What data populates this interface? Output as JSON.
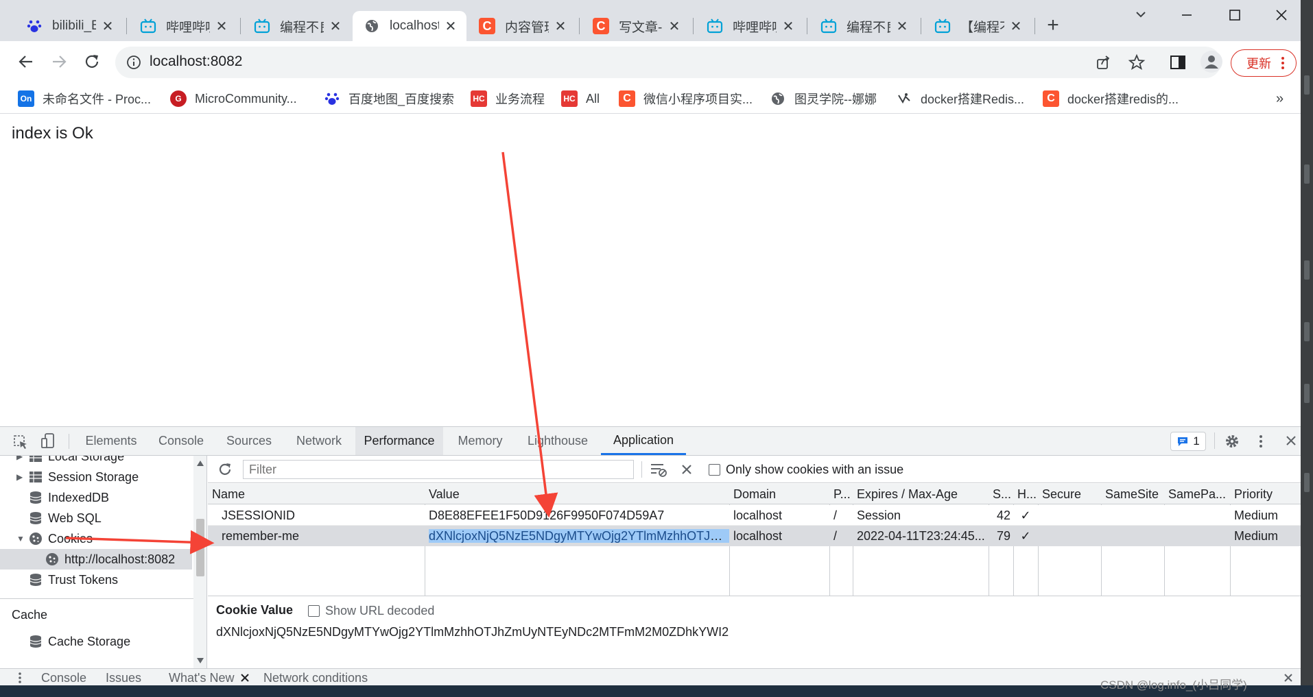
{
  "browser": {
    "tabs": [
      {
        "title": "bilibili_B",
        "icon": "baidu-paw-icon"
      },
      {
        "title": "哔哩哔哩",
        "icon": "bilibili-tv-icon"
      },
      {
        "title": "编程不良",
        "icon": "bilibili-tv-icon"
      },
      {
        "title": "localhost",
        "icon": "globe-icon",
        "active": true
      },
      {
        "title": "内容管理",
        "icon": "csdn-c-icon"
      },
      {
        "title": "写文章-C",
        "icon": "csdn-c-icon"
      },
      {
        "title": "哔哩哔哩",
        "icon": "bilibili-tv-icon"
      },
      {
        "title": "编程不良",
        "icon": "bilibili-tv-icon"
      },
      {
        "title": "【编程不",
        "icon": "bilibili-tv-icon"
      }
    ],
    "new_tab": "+",
    "address": "localhost:8082",
    "update_label": "更新",
    "bookmarks": [
      {
        "label": "未命名文件 - Proc...",
        "icon": "on-icon"
      },
      {
        "label": "MicroCommunity...",
        "icon": "gitee-icon"
      },
      {
        "label": "百度地图_百度搜索",
        "icon": "baidu-paw-icon"
      },
      {
        "label": "业务流程",
        "icon": "hc-icon"
      },
      {
        "label": "All",
        "icon": "hc-icon"
      },
      {
        "label": "微信小程序项目实...",
        "icon": "csdn-c-icon"
      },
      {
        "label": "图灵学院--娜娜",
        "icon": "globe-icon"
      },
      {
        "label": "docker搭建Redis...",
        "icon": "bird-icon"
      },
      {
        "label": "docker搭建redis的...",
        "icon": "csdn-c-icon"
      }
    ],
    "bookmarks_more": "»",
    "colors": {
      "tabstrip": "#dee1e6",
      "accent": "#1a73e8",
      "csdn": "#fc5531",
      "bilibili": "#00a1d6",
      "hc": "#e53935"
    }
  },
  "page": {
    "text": "index is Ok"
  },
  "devtools": {
    "tabs": [
      "Elements",
      "Console",
      "Sources",
      "Network",
      "Performance",
      "Memory",
      "Lighthouse",
      "Application"
    ],
    "active_tab": "Application",
    "issues_count": "1",
    "sidebar": {
      "items": [
        {
          "label": "Local Storage",
          "icon": "grid-icon"
        },
        {
          "label": "Session Storage",
          "icon": "grid-icon"
        },
        {
          "label": "IndexedDB",
          "icon": "database-icon"
        },
        {
          "label": "Web SQL",
          "icon": "database-icon"
        },
        {
          "label": "Cookies",
          "icon": "cookie-icon"
        },
        {
          "label": "http://localhost:8082",
          "icon": "cookie-icon"
        },
        {
          "label": "Trust Tokens",
          "icon": "database-icon"
        }
      ],
      "section_cache": "Cache",
      "cache_items": [
        {
          "label": "Cache Storage",
          "icon": "database-icon"
        }
      ]
    },
    "cookies": {
      "filter_placeholder": "Filter",
      "only_issue_label": "Only show cookies with an issue",
      "columns": [
        "Name",
        "Value",
        "Domain",
        "P...",
        "Expires / Max-Age",
        "S...",
        "H...",
        "Secure",
        "SameSite",
        "SamePa...",
        "Priority"
      ],
      "rows": [
        [
          "JSESSIONID",
          "D8E88EFEE1F50D9126F9950F074D59A7",
          "localhost",
          "/",
          "Session",
          "42",
          "✓",
          "",
          "",
          "",
          "Medium"
        ],
        [
          "remember-me",
          "dXNlcjoxNjQ5NzE5NDgyMTYwOjg2YTlmMzhhOTJhZmUyNTEyNDc2MTFmM2M0ZDhkYWI2",
          "localhost",
          "/",
          "2022-04-11T23:24:45...",
          "79",
          "✓",
          "",
          "",
          "",
          "Medium"
        ]
      ],
      "selected_row": 1,
      "cookie_value_label": "Cookie Value",
      "show_url_decoded_label": "Show URL decoded",
      "cookie_value": "dXNlcjoxNjQ5NzE5NDgyMTYwOjg2YTlmMzhhOTJhZmUyNTEyNDc2MTFmM2M0ZDhkYWI2"
    },
    "drawer_tabs": [
      "Console",
      "Issues",
      "What's New",
      "Network conditions"
    ]
  },
  "watermark": "CSDN @log.info_(小吕同学)"
}
